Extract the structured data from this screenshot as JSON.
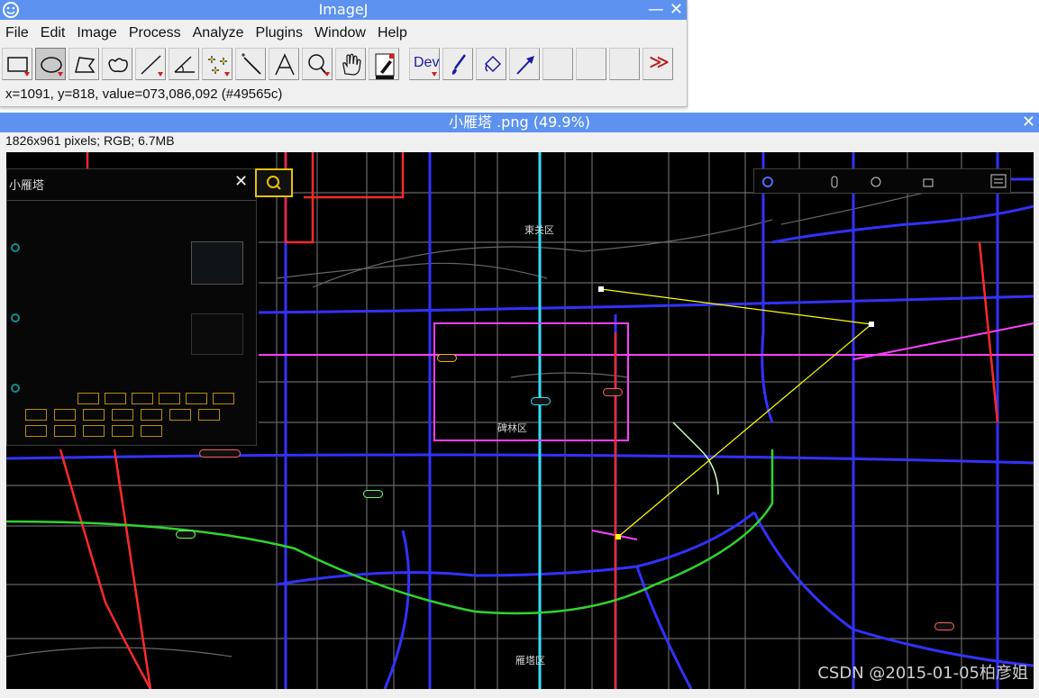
{
  "app": {
    "title": "ImageJ",
    "minimize_glyph": "—",
    "close_glyph": "✕"
  },
  "menu": [
    "File",
    "Edit",
    "Image",
    "Process",
    "Analyze",
    "Plugins",
    "Window",
    "Help"
  ],
  "toolbar": {
    "tools": [
      {
        "name": "rectangle-tool-icon"
      },
      {
        "name": "oval-tool-icon",
        "selected": true
      },
      {
        "name": "polygon-tool-icon"
      },
      {
        "name": "freehand-tool-icon"
      },
      {
        "name": "line-tool-icon"
      },
      {
        "name": "angle-tool-icon"
      },
      {
        "name": "multipoint-tool-icon"
      },
      {
        "name": "wand-tool-icon"
      },
      {
        "name": "text-tool-icon"
      },
      {
        "name": "magnifier-tool-icon"
      },
      {
        "name": "hand-tool-icon"
      },
      {
        "name": "color-picker-tool-icon"
      },
      {
        "name": "dev-menu-icon"
      },
      {
        "name": "paintbrush-tool-icon"
      },
      {
        "name": "flood-fill-tool-icon"
      },
      {
        "name": "arrow-tool-icon"
      },
      {
        "name": "empty-slot"
      },
      {
        "name": "empty-slot"
      },
      {
        "name": "empty-slot"
      },
      {
        "name": "more-tools-icon"
      }
    ],
    "dev_label": "Dev",
    "more_glyph": "≫"
  },
  "status": "x=1091, y=818, value=073,086,092 (#49565c)",
  "image_window": {
    "title": "小雁塔 .png (49.9%)",
    "info": "1826x961 pixels; RGB; 6.7MB",
    "close_glyph": "✕"
  },
  "map": {
    "search_text": "小雁塔",
    "search_clear_glyph": "✕",
    "district_labels": [
      "東关区",
      "碑林区",
      "雁塔区"
    ],
    "watermark": "CSDN @2015-01-05柏彦姐"
  },
  "colors": {
    "title_bar": "#5d92f0",
    "window_bg": "#f0f0f0",
    "roi_line": "#ffff00",
    "road_blue": "#3232ff",
    "road_red": "#ff2a2a",
    "road_magenta": "#ff40ff",
    "road_green": "#2fd52f",
    "road_cyan": "#30e0ff"
  }
}
